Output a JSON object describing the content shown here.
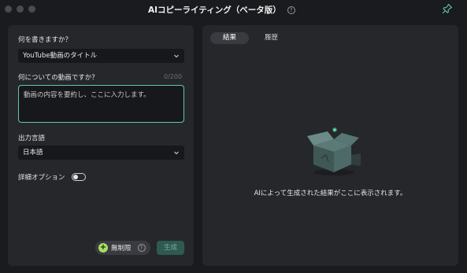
{
  "window": {
    "title": "AIコピーライティング（ベータ版）"
  },
  "left": {
    "what_to_write_label": "何を書きますか？",
    "what_to_write_value": "YouTube動画のタイトル",
    "topic_label": "何についての動画ですか？",
    "topic_counter": "0/200",
    "topic_placeholder": "動画の内容を要約し、ここに入力します。",
    "language_label": "出力言語",
    "language_value": "日本語",
    "advanced_label": "詳細オプション",
    "advanced_enabled": false,
    "unlimited_label": "無制限",
    "generate_label": "生成"
  },
  "right": {
    "tabs": [
      "結果",
      "履歴"
    ],
    "active_tab": "結果",
    "empty_message": "AIによって生成された結果がここに表示されます。"
  },
  "colors": {
    "accent": "#5fc8b4",
    "generate_bg": "#2d5a51",
    "plus_green": "#a6e05f"
  }
}
